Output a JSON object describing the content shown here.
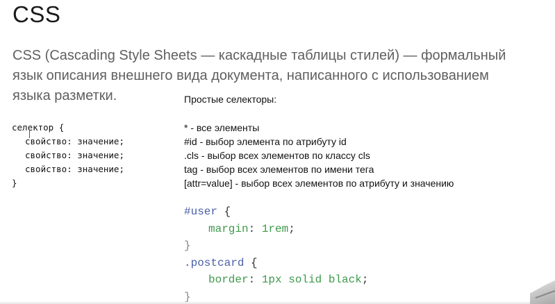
{
  "slide": {
    "title": "CSS",
    "intro_lines": [
      "CSS (Cascading Style Sheets — каскадные таблицы стилей) — формальный",
      "язык описания внешнего вида документа, написанного с использованием",
      "языка разметки."
    ],
    "rule_syntax": {
      "open": "селектор {",
      "declarations": [
        "свойство: значение;",
        "свойство: значение;",
        "свойство: значение;"
      ],
      "close": "}"
    },
    "simple_selectors": {
      "heading": "Простые селекторы:",
      "items": [
        "* - все элементы",
        "#id - выбор элемента по атрибуту id",
        ".cls - выбор всех элементов по классу cls",
        "tag - выбор всех элементов по имени тега",
        "[attr=value] - выбор всех элементов по атрибуту и значению"
      ]
    },
    "code_example": {
      "rule1_selector": "#user",
      "rule1_open": " {",
      "rule1_prop": "margin",
      "rule1_colon": ": ",
      "rule1_value": "1rem",
      "rule1_semi": ";",
      "rule1_close": "}",
      "rule2_selector": ".postcard",
      "rule2_open": " {",
      "rule2_prop": "border",
      "rule2_colon": ": ",
      "rule2_value": "1px solid black",
      "rule2_semi": ";",
      "rule2_close": "}"
    },
    "colors": {
      "selector": "#4a5fa8",
      "property": "#3e9a4b",
      "intro_text": "#5f5f5f"
    }
  }
}
